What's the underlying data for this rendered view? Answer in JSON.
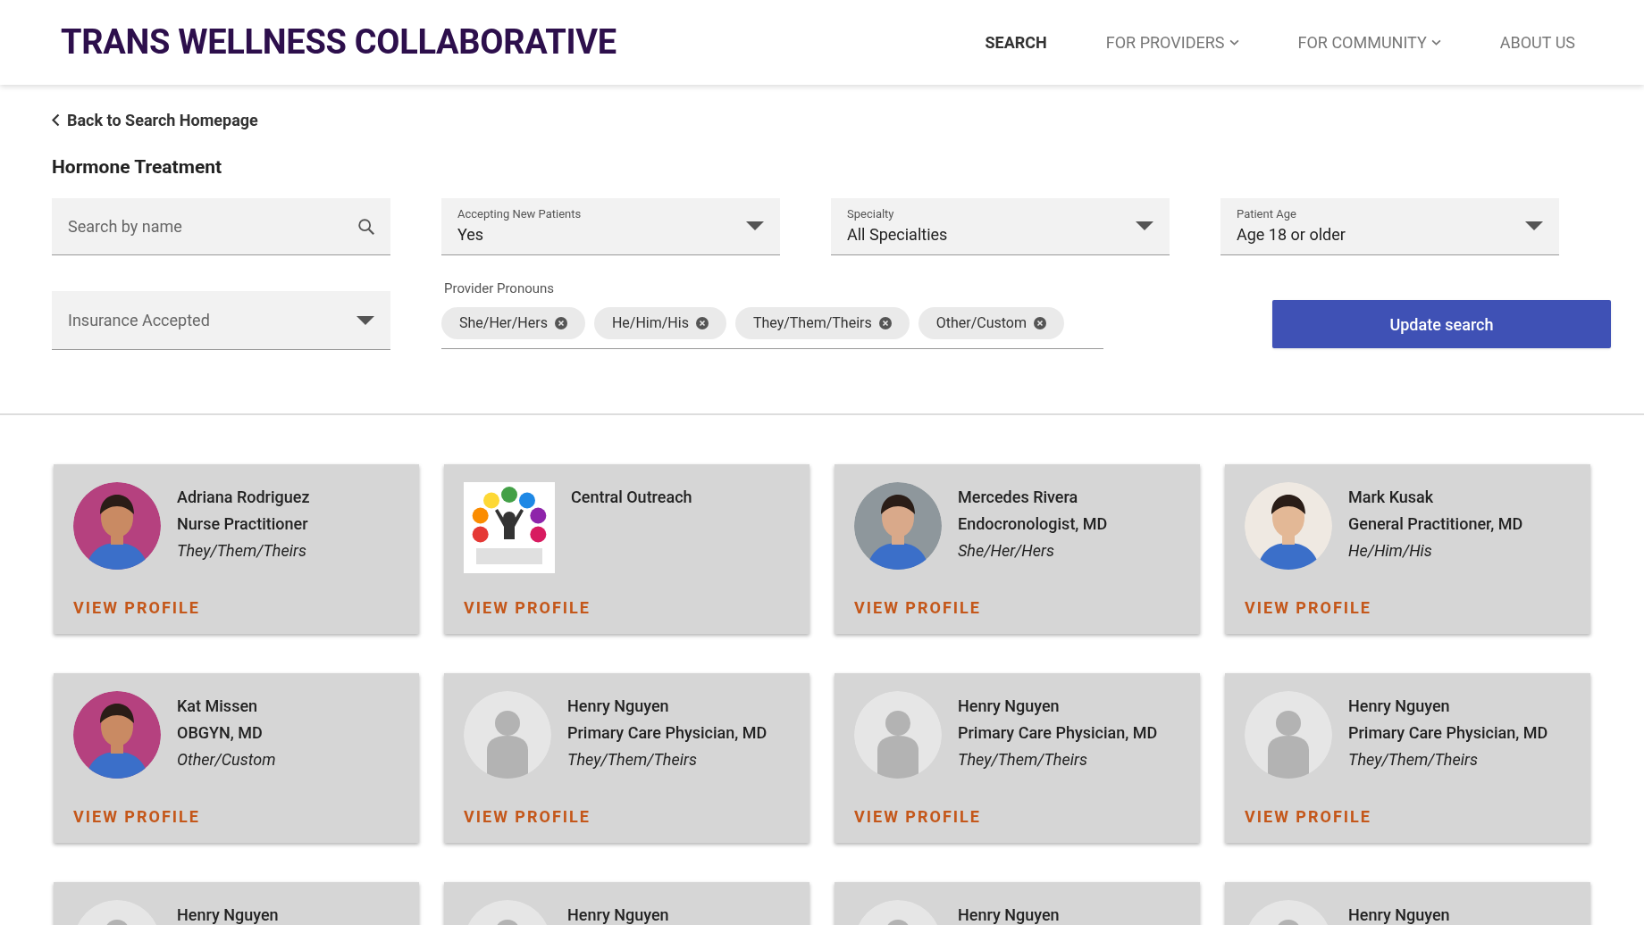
{
  "header": {
    "title": "TRANS WELLNESS COLLABORATIVE",
    "nav": [
      {
        "label": "SEARCH",
        "selected": true,
        "dropdown": false
      },
      {
        "label": "FOR PROVIDERS",
        "selected": false,
        "dropdown": true
      },
      {
        "label": "FOR COMMUNITY",
        "selected": false,
        "dropdown": true
      },
      {
        "label": "ABOUT US",
        "selected": false,
        "dropdown": false
      }
    ]
  },
  "back_link": "Back to Search Homepage",
  "heading": "Hormone Treatment",
  "filters": {
    "search": {
      "placeholder": "Search by name"
    },
    "selects": [
      {
        "label": "Accepting New Patients",
        "value": "Yes"
      },
      {
        "label": "Specialty",
        "value": "All Specialties"
      },
      {
        "label": "Patient Age",
        "value": "Age 18 or older"
      }
    ],
    "insurance": {
      "placeholder": "Insurance Accepted"
    },
    "pronouns": {
      "label": "Provider Pronouns",
      "chips": [
        "She/Her/Hers",
        "He/Him/His",
        "They/Them/Theirs",
        "Other/Custom"
      ]
    },
    "button": "Update search"
  },
  "providers": [
    {
      "name": "Adriana Rodriguez",
      "role": "Nurse Practitioner",
      "pronouns": "They/Them/Theirs",
      "link": "VIEW PROFILE"
    },
    {
      "kind": "logo",
      "name": "Central Outreach",
      "link": "VIEW PROFILE"
    },
    {
      "name": "Mercedes Rivera",
      "role": "Endocronologist, MD",
      "pronouns": "She/Her/Hers",
      "link": "VIEW PROFILE"
    },
    {
      "name": "Mark Kusak",
      "role": "General Practitioner, MD",
      "pronouns": "He/Him/His",
      "link": "VIEW PROFILE"
    },
    {
      "name": "Kat Missen",
      "role": "OBGYN, MD",
      "pronouns": "Other/Custom",
      "link": "VIEW PROFILE"
    },
    {
      "kind": "placeholder",
      "name": "Henry Nguyen",
      "role": "Primary Care Physician, MD",
      "pronouns": "They/Them/Theirs",
      "link": "VIEW PROFILE"
    },
    {
      "kind": "placeholder",
      "name": "Henry Nguyen",
      "role": "Primary Care Physician, MD",
      "pronouns": "They/Them/Theirs",
      "link": "VIEW PROFILE"
    },
    {
      "kind": "placeholder",
      "name": "Henry Nguyen",
      "role": "Primary Care Physician, MD",
      "pronouns": "They/Them/Theirs",
      "link": "VIEW PROFILE"
    },
    {
      "kind": "placeholder",
      "name": "Henry Nguyen"
    },
    {
      "kind": "placeholder",
      "name": "Henry Nguyen"
    },
    {
      "kind": "placeholder",
      "name": "Henry Nguyen"
    },
    {
      "kind": "placeholder",
      "name": "Henry Nguyen"
    }
  ]
}
